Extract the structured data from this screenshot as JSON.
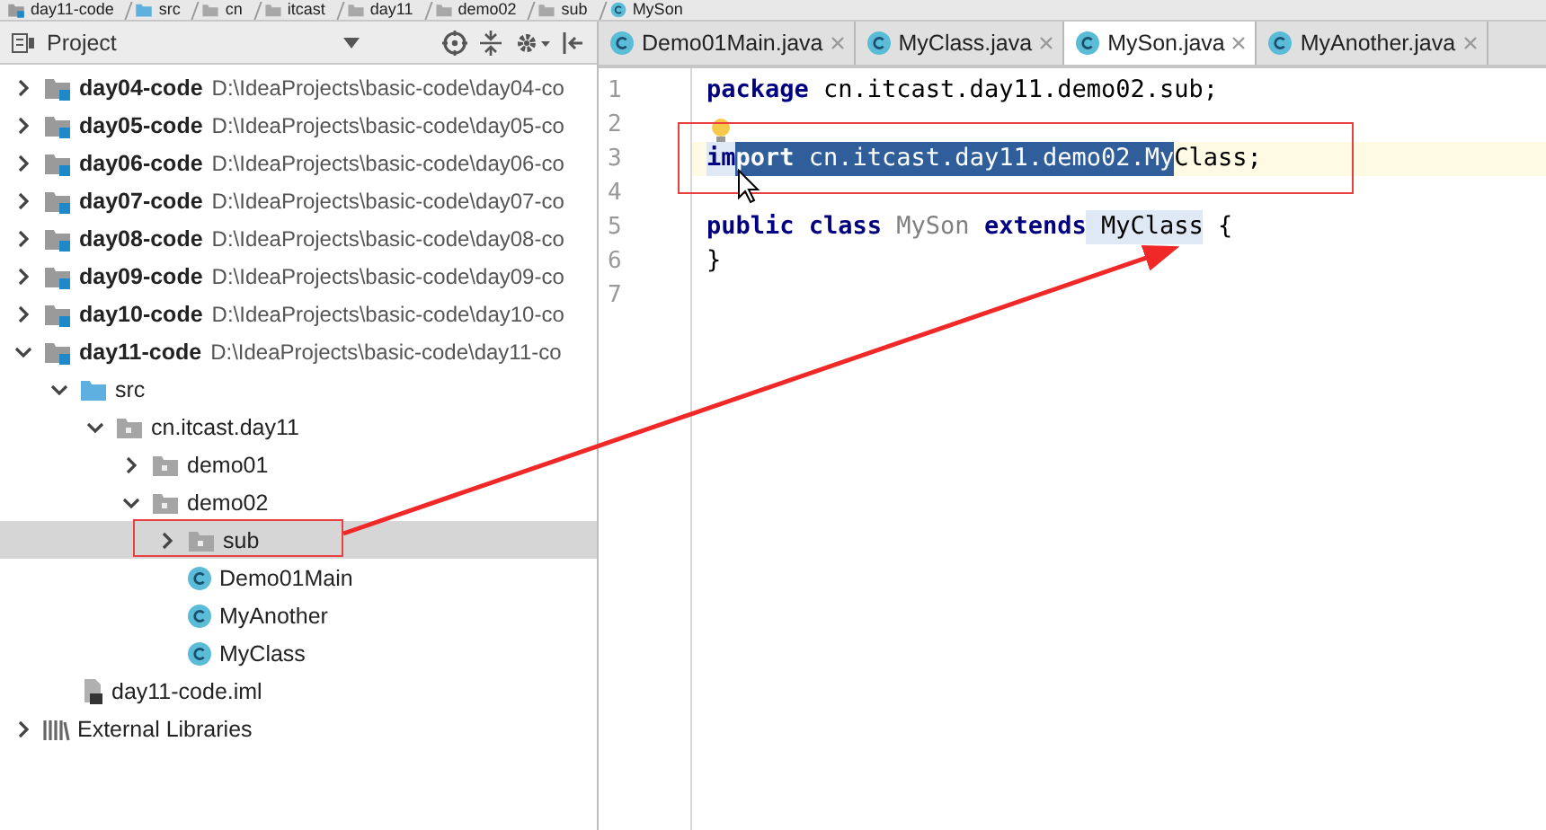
{
  "breadcrumb": [
    {
      "label": "day11-code",
      "kind": "module"
    },
    {
      "label": "src",
      "kind": "source"
    },
    {
      "label": "cn",
      "kind": "folder"
    },
    {
      "label": "itcast",
      "kind": "folder"
    },
    {
      "label": "day11",
      "kind": "folder"
    },
    {
      "label": "demo02",
      "kind": "folder"
    },
    {
      "label": "sub",
      "kind": "folder"
    },
    {
      "label": "MySon",
      "kind": "class"
    }
  ],
  "project_panel": {
    "title": "Project",
    "tree": [
      {
        "label": "day04-code",
        "path": "D:\\IdeaProjects\\basic-code\\day04-co",
        "kind": "module",
        "expanded": false,
        "selected": false
      },
      {
        "label": "day05-code",
        "path": "D:\\IdeaProjects\\basic-code\\day05-co",
        "kind": "module",
        "expanded": false,
        "selected": false
      },
      {
        "label": "day06-code",
        "path": "D:\\IdeaProjects\\basic-code\\day06-co",
        "kind": "module",
        "expanded": false,
        "selected": false
      },
      {
        "label": "day07-code",
        "path": "D:\\IdeaProjects\\basic-code\\day07-co",
        "kind": "module",
        "expanded": false,
        "selected": false
      },
      {
        "label": "day08-code",
        "path": "D:\\IdeaProjects\\basic-code\\day08-co",
        "kind": "module",
        "expanded": false,
        "selected": false
      },
      {
        "label": "day09-code",
        "path": "D:\\IdeaProjects\\basic-code\\day09-co",
        "kind": "module",
        "expanded": false,
        "selected": false
      },
      {
        "label": "day10-code",
        "path": "D:\\IdeaProjects\\basic-code\\day10-co",
        "kind": "module",
        "expanded": false,
        "selected": false
      },
      {
        "label": "day11-code",
        "path": "D:\\IdeaProjects\\basic-code\\day11-co",
        "kind": "module",
        "expanded": true,
        "selected": false,
        "children": [
          {
            "label": "src",
            "kind": "source",
            "expanded": true,
            "selected": false,
            "children": [
              {
                "label": "cn.itcast.day11",
                "kind": "package",
                "expanded": true,
                "selected": false,
                "children": [
                  {
                    "label": "demo01",
                    "kind": "package",
                    "expanded": false,
                    "selected": false
                  },
                  {
                    "label": "demo02",
                    "kind": "package",
                    "expanded": true,
                    "selected": false,
                    "children": [
                      {
                        "label": "sub",
                        "kind": "package",
                        "expanded": false,
                        "selected": true
                      },
                      {
                        "label": "Demo01Main",
                        "kind": "class",
                        "selected": false
                      },
                      {
                        "label": "MyAnother",
                        "kind": "class",
                        "selected": false
                      },
                      {
                        "label": "MyClass",
                        "kind": "class",
                        "selected": false
                      }
                    ]
                  }
                ]
              }
            ]
          },
          {
            "label": "day11-code.iml",
            "kind": "iml",
            "selected": false
          }
        ]
      },
      {
        "label": "External Libraries",
        "kind": "libraries",
        "expanded": false,
        "selected": false
      }
    ]
  },
  "editor": {
    "tabs": [
      {
        "label": "Demo01Main.java",
        "selected": false
      },
      {
        "label": "MyClass.java",
        "selected": false
      },
      {
        "label": "MySon.java",
        "selected": true
      },
      {
        "label": "MyAnother.java",
        "selected": false
      }
    ],
    "lines": [
      {
        "number": "1",
        "current": false,
        "bulb": false,
        "segments": [
          {
            "text": "package",
            "kind": "keyword",
            "selected": false,
            "highlighted": false
          },
          {
            "text": " cn.itcast.day11.demo02.sub;",
            "kind": "plain",
            "selected": false,
            "highlighted": false
          }
        ]
      },
      {
        "number": "2",
        "current": false,
        "bulb": true
      },
      {
        "number": "3",
        "current": true,
        "bulb": false,
        "segments": [
          {
            "text": "im",
            "kind": "keyword",
            "selected": false,
            "highlighted": true
          },
          {
            "text": "port",
            "kind": "keyword",
            "selected": true,
            "highlighted": false
          },
          {
            "text": " cn.itcast.day11.demo02.My",
            "kind": "plain",
            "selected": true,
            "highlighted": false
          },
          {
            "text": "Class;",
            "kind": "plain",
            "selected": false,
            "highlighted": false
          }
        ]
      },
      {
        "number": "4",
        "current": false,
        "bulb": false
      },
      {
        "number": "5",
        "current": false,
        "bulb": false,
        "segments": [
          {
            "text": "public class",
            "kind": "keyword",
            "selected": false,
            "highlighted": false
          },
          {
            "text": " MySon ",
            "kind": "unused",
            "selected": false,
            "highlighted": false
          },
          {
            "text": "extends",
            "kind": "keyword",
            "selected": false,
            "highlighted": false
          },
          {
            "text": " MyClass",
            "kind": "plain",
            "selected": false,
            "highlighted": true
          },
          {
            "text": " {",
            "kind": "plain",
            "selected": false,
            "highlighted": false
          }
        ]
      },
      {
        "number": "6",
        "current": false,
        "bulb": false,
        "segments": [
          {
            "text": "}",
            "kind": "plain",
            "selected": false,
            "highlighted": false
          }
        ]
      },
      {
        "number": "7",
        "current": false,
        "bulb": false
      }
    ]
  }
}
